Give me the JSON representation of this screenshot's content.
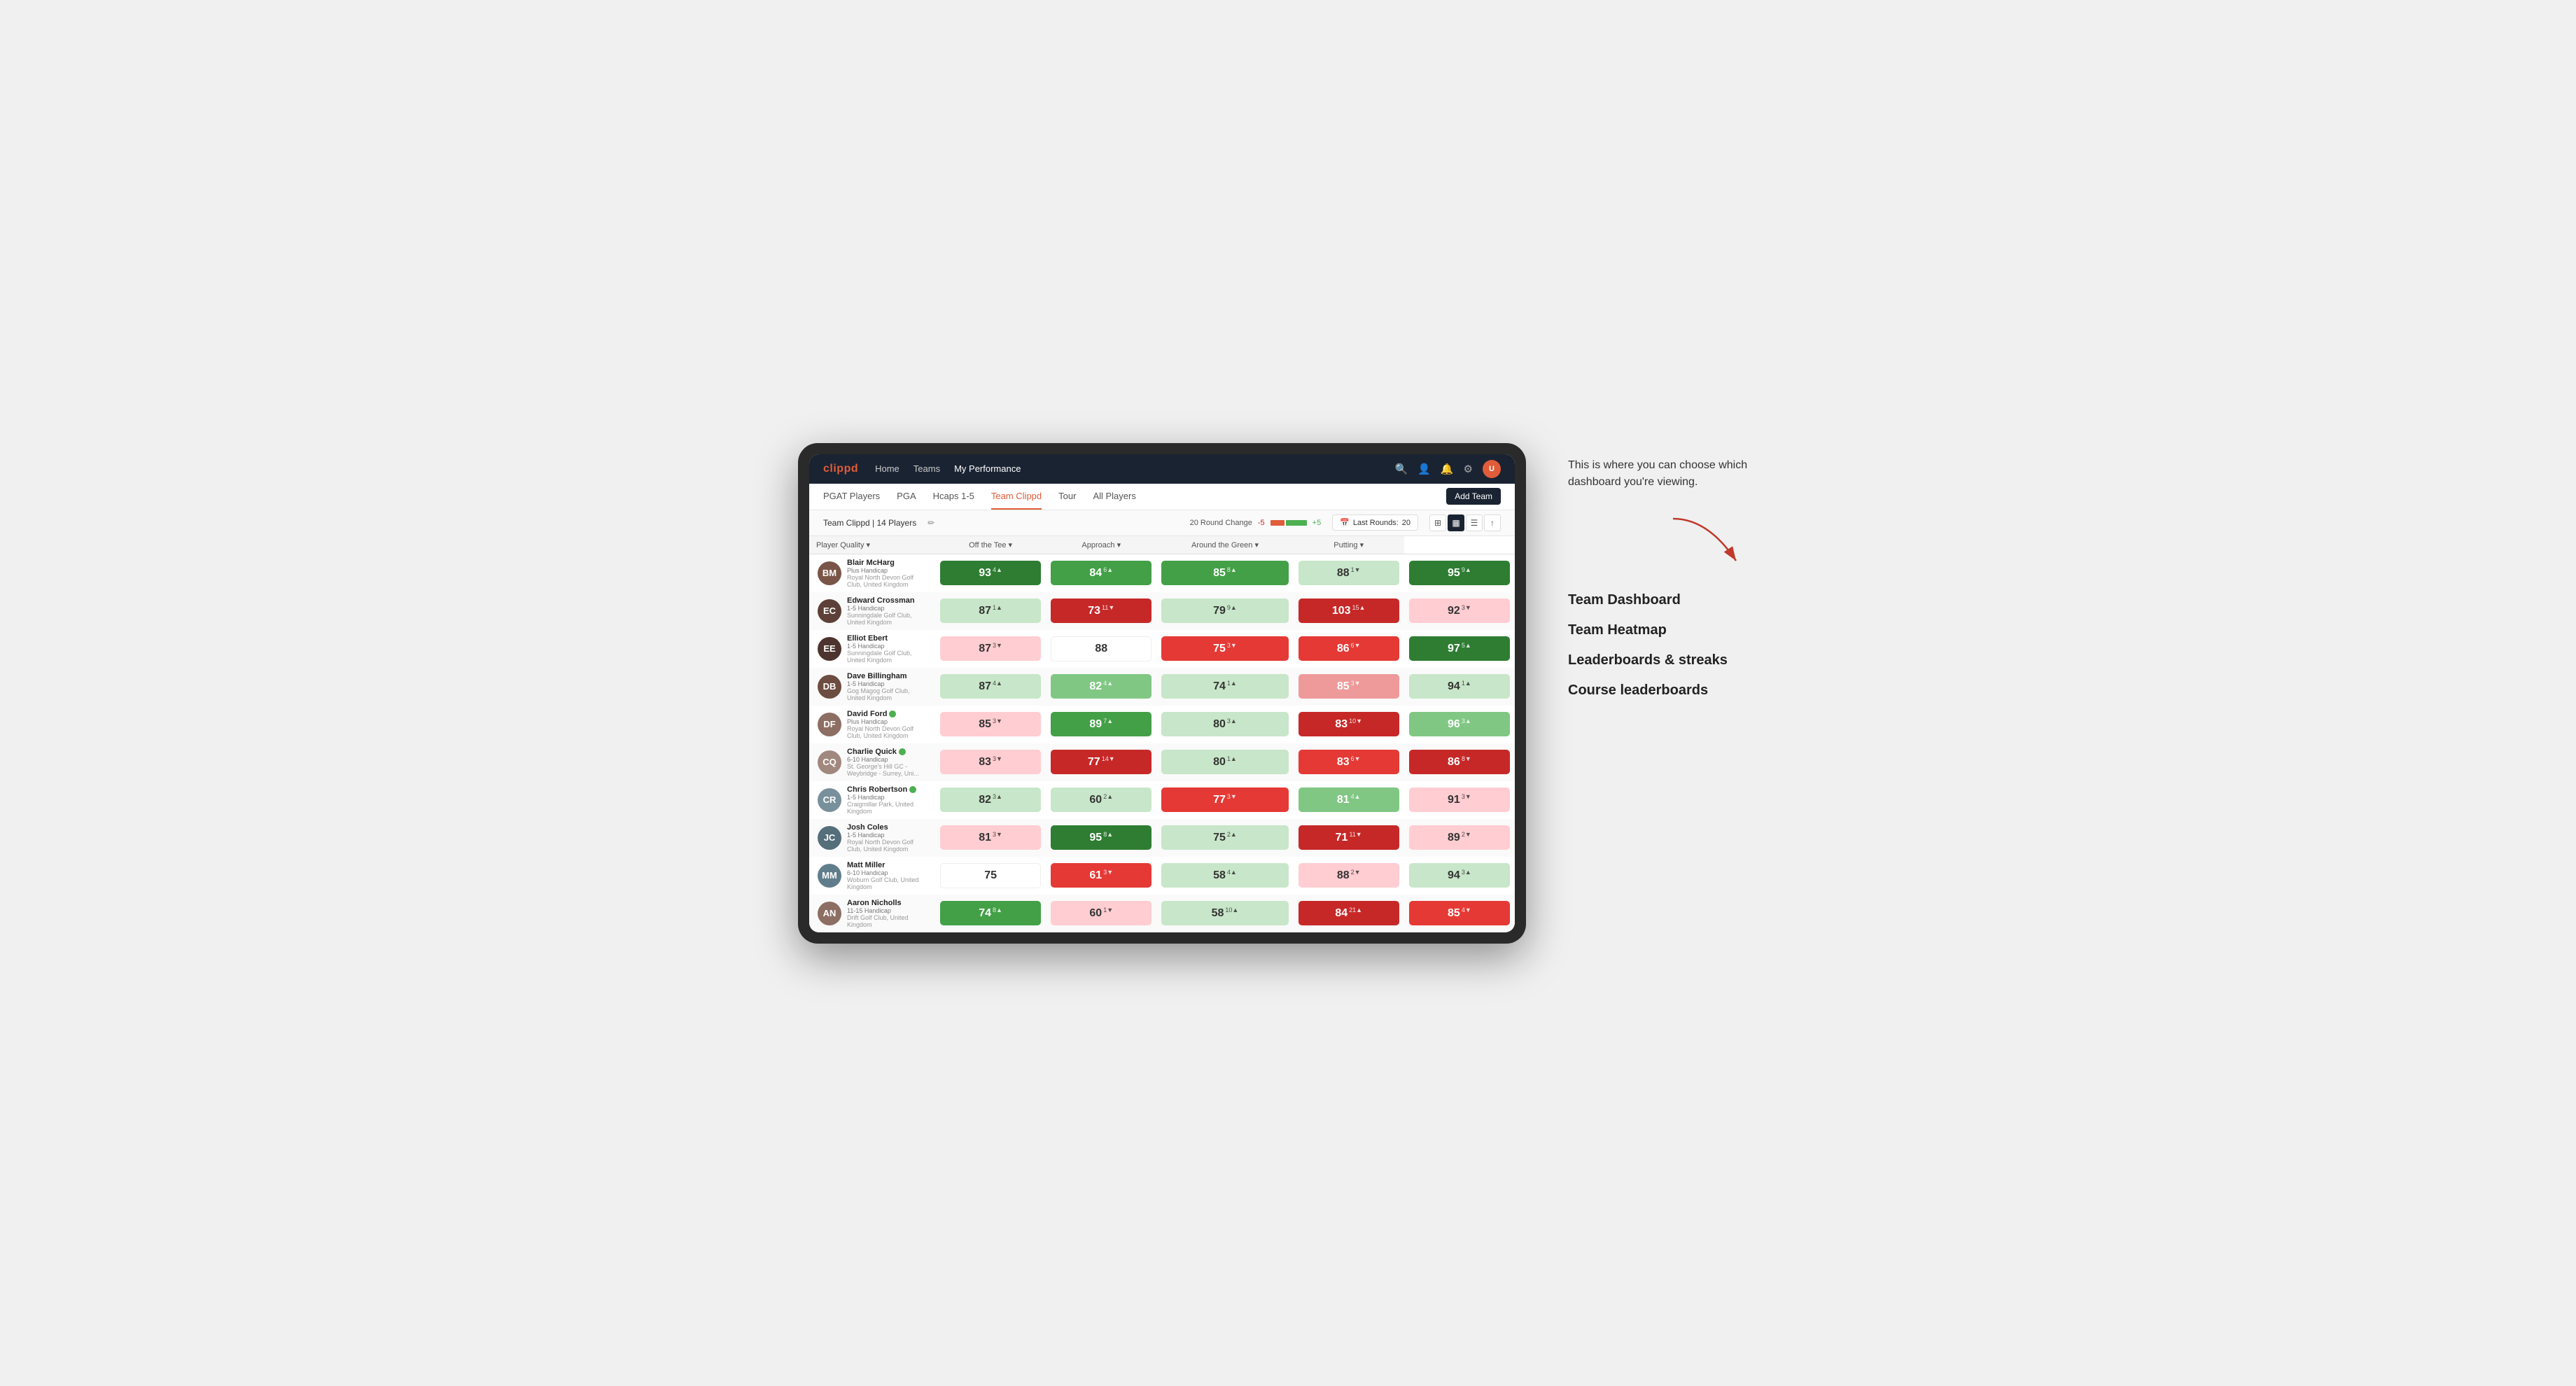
{
  "annotation": {
    "text": "This is where you can choose which dashboard you're viewing.",
    "arrow_label": "→"
  },
  "menu_items": [
    {
      "label": "Team Dashboard"
    },
    {
      "label": "Team Heatmap"
    },
    {
      "label": "Leaderboards & streaks"
    },
    {
      "label": "Course leaderboards"
    }
  ],
  "top_nav": {
    "logo": "clippd",
    "links": [
      "Home",
      "Teams",
      "My Performance"
    ],
    "active_link": "My Performance"
  },
  "sub_nav": {
    "links": [
      "PGAT Players",
      "PGA",
      "Hcaps 1-5",
      "Team Clippd",
      "Tour",
      "All Players"
    ],
    "active_link": "Team Clippd",
    "add_team_label": "Add Team"
  },
  "team_bar": {
    "name": "Team Clippd",
    "player_count": "14 Players",
    "round_change_label": "20 Round Change",
    "change_neg": "-5",
    "change_pos": "+5",
    "last_rounds_label": "Last Rounds:",
    "last_rounds_value": "20"
  },
  "table": {
    "headers": {
      "player": "Player Quality ▾",
      "off_tee": "Off the Tee ▾",
      "approach": "Approach ▾",
      "around_green": "Around the Green ▾",
      "putting": "Putting ▾"
    },
    "rows": [
      {
        "name": "Blair McHarg",
        "hcp": "Plus Handicap",
        "club": "Royal North Devon Golf Club, United Kingdom",
        "initials": "BM",
        "avatar_color": "#795548",
        "scores": {
          "quality": {
            "val": "93",
            "change": "4",
            "dir": "up",
            "color": "green-dark"
          },
          "off_tee": {
            "val": "84",
            "change": "6",
            "dir": "up",
            "color": "green-mid"
          },
          "approach": {
            "val": "85",
            "change": "8",
            "dir": "up",
            "color": "green-mid"
          },
          "around_green": {
            "val": "88",
            "change": "1",
            "dir": "down",
            "color": "light-green"
          },
          "putting": {
            "val": "95",
            "change": "9",
            "dir": "up",
            "color": "green-dark"
          }
        }
      },
      {
        "name": "Edward Crossman",
        "hcp": "1-5 Handicap",
        "club": "Sunningdale Golf Club, United Kingdom",
        "initials": "EC",
        "avatar_color": "#5d4037",
        "scores": {
          "quality": {
            "val": "87",
            "change": "1",
            "dir": "up",
            "color": "light-green"
          },
          "off_tee": {
            "val": "73",
            "change": "11",
            "dir": "down",
            "color": "red-dark"
          },
          "approach": {
            "val": "79",
            "change": "9",
            "dir": "up",
            "color": "light-green"
          },
          "around_green": {
            "val": "103",
            "change": "15",
            "dir": "up",
            "color": "red-dark"
          },
          "putting": {
            "val": "92",
            "change": "3",
            "dir": "down",
            "color": "light-red"
          }
        }
      },
      {
        "name": "Elliot Ebert",
        "hcp": "1-5 Handicap",
        "club": "Sunningdale Golf Club, United Kingdom",
        "initials": "EE",
        "avatar_color": "#4e342e",
        "scores": {
          "quality": {
            "val": "87",
            "change": "3",
            "dir": "down",
            "color": "light-red"
          },
          "off_tee": {
            "val": "88",
            "change": "",
            "dir": "",
            "color": "neutral"
          },
          "approach": {
            "val": "75",
            "change": "3",
            "dir": "down",
            "color": "red-mid"
          },
          "around_green": {
            "val": "86",
            "change": "6",
            "dir": "down",
            "color": "red-mid"
          },
          "putting": {
            "val": "97",
            "change": "5",
            "dir": "up",
            "color": "green-dark"
          }
        }
      },
      {
        "name": "Dave Billingham",
        "hcp": "1-5 Handicap",
        "club": "Gog Magog Golf Club, United Kingdom",
        "initials": "DB",
        "avatar_color": "#6d4c41",
        "scores": {
          "quality": {
            "val": "87",
            "change": "4",
            "dir": "up",
            "color": "light-green"
          },
          "off_tee": {
            "val": "82",
            "change": "4",
            "dir": "up",
            "color": "green-light"
          },
          "approach": {
            "val": "74",
            "change": "1",
            "dir": "up",
            "color": "light-green"
          },
          "around_green": {
            "val": "85",
            "change": "3",
            "dir": "down",
            "color": "red-light"
          },
          "putting": {
            "val": "94",
            "change": "1",
            "dir": "up",
            "color": "light-green"
          }
        }
      },
      {
        "name": "David Ford",
        "hcp": "Plus Handicap",
        "club": "Royal North Devon Golf Club, United Kingdom",
        "initials": "DF",
        "has_badge": true,
        "avatar_color": "#8d6e63",
        "scores": {
          "quality": {
            "val": "85",
            "change": "3",
            "dir": "down",
            "color": "light-red"
          },
          "off_tee": {
            "val": "89",
            "change": "7",
            "dir": "up",
            "color": "green-mid"
          },
          "approach": {
            "val": "80",
            "change": "3",
            "dir": "up",
            "color": "light-green"
          },
          "around_green": {
            "val": "83",
            "change": "10",
            "dir": "down",
            "color": "red-dark"
          },
          "putting": {
            "val": "96",
            "change": "3",
            "dir": "up",
            "color": "green-light"
          }
        }
      },
      {
        "name": "Charlie Quick",
        "hcp": "6-10 Handicap",
        "club": "St. George's Hill GC - Weybridge - Surrey, Uni...",
        "initials": "CQ",
        "has_badge": true,
        "avatar_color": "#a1887f",
        "scores": {
          "quality": {
            "val": "83",
            "change": "3",
            "dir": "down",
            "color": "light-red"
          },
          "off_tee": {
            "val": "77",
            "change": "14",
            "dir": "down",
            "color": "red-dark"
          },
          "approach": {
            "val": "80",
            "change": "1",
            "dir": "up",
            "color": "light-green"
          },
          "around_green": {
            "val": "83",
            "change": "6",
            "dir": "down",
            "color": "red-mid"
          },
          "putting": {
            "val": "86",
            "change": "8",
            "dir": "down",
            "color": "red-dark"
          }
        }
      },
      {
        "name": "Chris Robertson",
        "hcp": "1-5 Handicap",
        "club": "Craigmillar Park, United Kingdom",
        "initials": "CR",
        "has_badge": true,
        "avatar_color": "#78909c",
        "scores": {
          "quality": {
            "val": "82",
            "change": "3",
            "dir": "up",
            "color": "light-green"
          },
          "off_tee": {
            "val": "60",
            "change": "2",
            "dir": "up",
            "color": "light-green"
          },
          "approach": {
            "val": "77",
            "change": "3",
            "dir": "down",
            "color": "red-mid"
          },
          "around_green": {
            "val": "81",
            "change": "4",
            "dir": "up",
            "color": "green-light"
          },
          "putting": {
            "val": "91",
            "change": "3",
            "dir": "down",
            "color": "light-red"
          }
        }
      },
      {
        "name": "Josh Coles",
        "hcp": "1-5 Handicap",
        "club": "Royal North Devon Golf Club, United Kingdom",
        "initials": "JC",
        "avatar_color": "#546e7a",
        "scores": {
          "quality": {
            "val": "81",
            "change": "3",
            "dir": "down",
            "color": "light-red"
          },
          "off_tee": {
            "val": "95",
            "change": "8",
            "dir": "up",
            "color": "green-dark"
          },
          "approach": {
            "val": "75",
            "change": "2",
            "dir": "up",
            "color": "light-green"
          },
          "around_green": {
            "val": "71",
            "change": "11",
            "dir": "down",
            "color": "red-dark"
          },
          "putting": {
            "val": "89",
            "change": "2",
            "dir": "down",
            "color": "light-red"
          }
        }
      },
      {
        "name": "Matt Miller",
        "hcp": "6-10 Handicap",
        "club": "Woburn Golf Club, United Kingdom",
        "initials": "MM",
        "avatar_color": "#607d8b",
        "scores": {
          "quality": {
            "val": "75",
            "change": "",
            "dir": "",
            "color": "neutral"
          },
          "off_tee": {
            "val": "61",
            "change": "3",
            "dir": "down",
            "color": "red-mid"
          },
          "approach": {
            "val": "58",
            "change": "4",
            "dir": "up",
            "color": "light-green"
          },
          "around_green": {
            "val": "88",
            "change": "2",
            "dir": "down",
            "color": "light-red"
          },
          "putting": {
            "val": "94",
            "change": "3",
            "dir": "up",
            "color": "light-green"
          }
        }
      },
      {
        "name": "Aaron Nicholls",
        "hcp": "11-15 Handicap",
        "club": "Drift Golf Club, United Kingdom",
        "initials": "AN",
        "avatar_color": "#8d6e63",
        "scores": {
          "quality": {
            "val": "74",
            "change": "8",
            "dir": "up",
            "color": "green-mid"
          },
          "off_tee": {
            "val": "60",
            "change": "1",
            "dir": "down",
            "color": "light-red"
          },
          "approach": {
            "val": "58",
            "change": "10",
            "dir": "up",
            "color": "light-green"
          },
          "around_green": {
            "val": "84",
            "change": "21",
            "dir": "up",
            "color": "red-dark"
          },
          "putting": {
            "val": "85",
            "change": "4",
            "dir": "down",
            "color": "red-mid"
          }
        }
      }
    ]
  }
}
